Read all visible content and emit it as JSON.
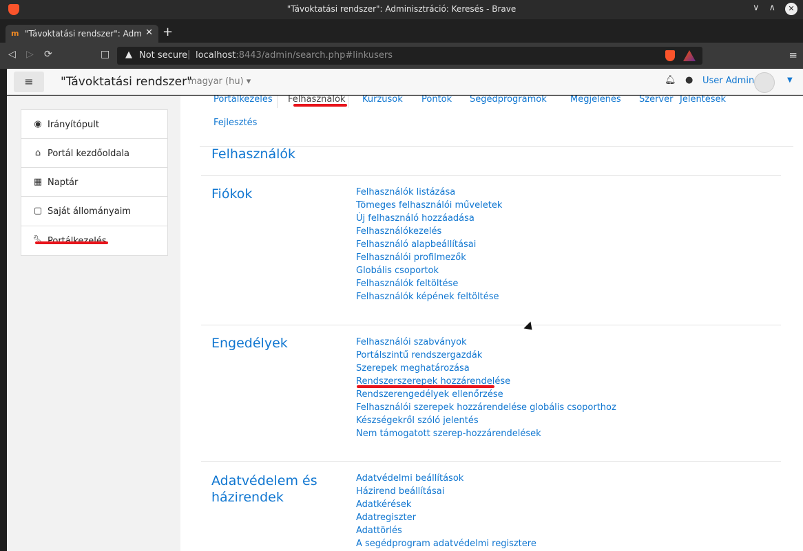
{
  "window": {
    "title": "\"Távoktatási rendszer\": Adminisztráció: Keresés - Brave"
  },
  "browser": {
    "tab_title": "\"Távoktatási rendszer\": Admini",
    "not_secure": "Not secure",
    "url_host": "localhost",
    "url_rest": ":8443/admin/search.php#linkusers"
  },
  "header": {
    "site_name": "\"Távoktatási rendszer\"",
    "language": "magyar (hu)",
    "user_name": "User Admin"
  },
  "nav": {
    "items": [
      {
        "label": "Irányítópult",
        "icon": "dashboard-icon"
      },
      {
        "label": "Portál kezdőoldala",
        "icon": "home-icon"
      },
      {
        "label": "Naptár",
        "icon": "calendar-icon"
      },
      {
        "label": "Saját állományaim",
        "icon": "file-icon"
      }
    ],
    "admin_item": {
      "label": "Portálkezelés",
      "icon": "wrench-icon"
    }
  },
  "tabs": [
    "Portálkezelés",
    "Felhasználók",
    "Kurzusok",
    "Pontok",
    "Segédprogramok",
    "Megjelenés",
    "Szerver",
    "Jelentések",
    "Fejlesztés"
  ],
  "main": {
    "heading": "Felhasználók",
    "sections": [
      {
        "title": "Fiókok",
        "links": [
          "Felhasználók listázása",
          "Tömeges felhasználói műveletek",
          "Új felhasználó hozzáadása",
          "Felhasználókezelés",
          "Felhasználó alapbeállításai",
          "Felhasználói profilmezők",
          "Globális csoportok",
          "Felhasználók feltöltése",
          "Felhasználók képének feltöltése"
        ]
      },
      {
        "title": "Engedélyek",
        "links": [
          "Felhasználói szabványok",
          "Portálszintű rendszergazdák",
          "Szerepek meghatározása",
          "Rendszerszerepek hozzárendelése",
          "Rendszerengedélyek ellenőrzése",
          "Felhasználói szerepek hozzárendelése globális csoporthoz",
          "Készségekről szóló jelentés",
          "Nem támogatott szerep-hozzárendelések"
        ]
      },
      {
        "title": "Adatvédelem és házirendek",
        "links": [
          "Adatvédelmi beállítások",
          "Házirend beállításai",
          "Adatkérések",
          "Adatregiszter",
          "Adattörlés",
          "A segédprogram adatvédelmi regisztere"
        ]
      }
    ]
  },
  "colors": {
    "link": "#1177d1",
    "highlight": "#e8141b",
    "brave": "#fb542b"
  }
}
